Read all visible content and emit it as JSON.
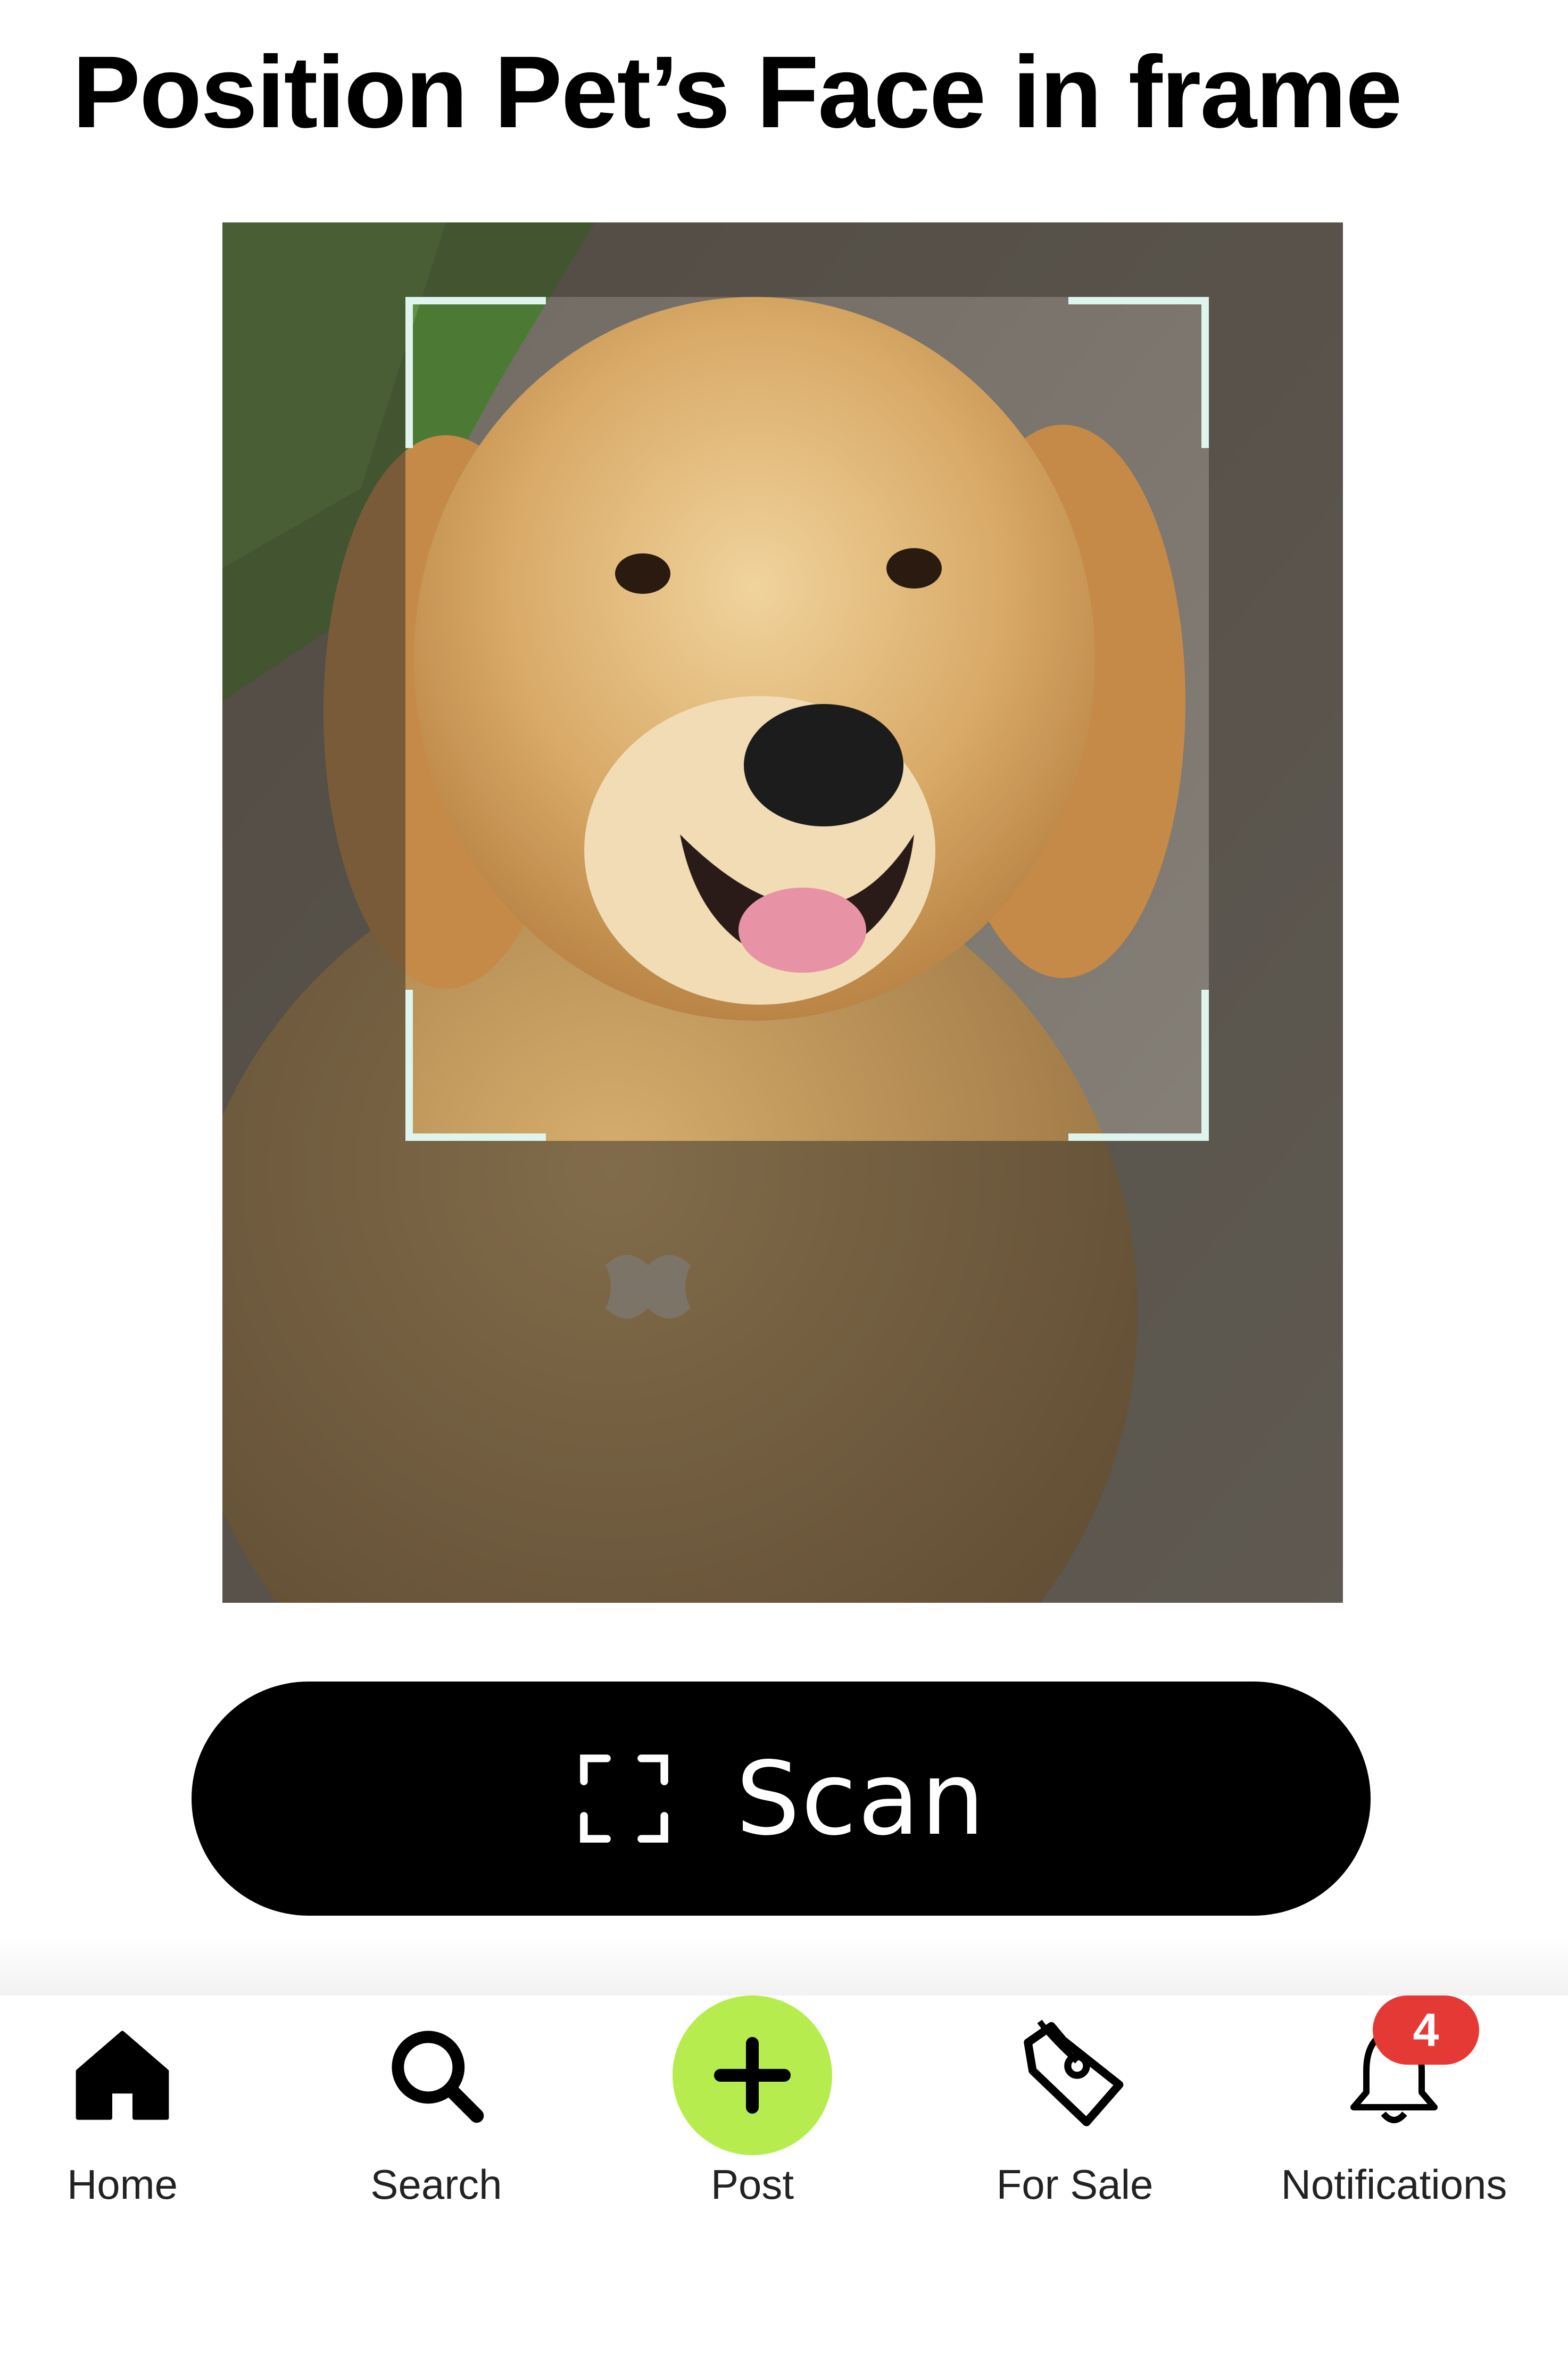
{
  "header": {
    "title": "Position Pet’s Face in frame"
  },
  "camera": {
    "subject": "golden-retriever-photo"
  },
  "scan_button": {
    "label": "Scan",
    "icon": "scan-frame-icon"
  },
  "bottom_nav": {
    "items": [
      {
        "label": "Home",
        "icon": "home-icon"
      },
      {
        "label": "Search",
        "icon": "search-icon"
      },
      {
        "label": "Post",
        "icon": "plus-icon"
      },
      {
        "label": "For Sale",
        "icon": "price-tag-icon"
      },
      {
        "label": "Notifications",
        "icon": "bell-icon",
        "badge": "4"
      }
    ]
  },
  "colors": {
    "accent_green": "#b6ec4d",
    "badge_red": "#e53935",
    "bracket": "#dff4ec",
    "button_bg": "#000000"
  }
}
